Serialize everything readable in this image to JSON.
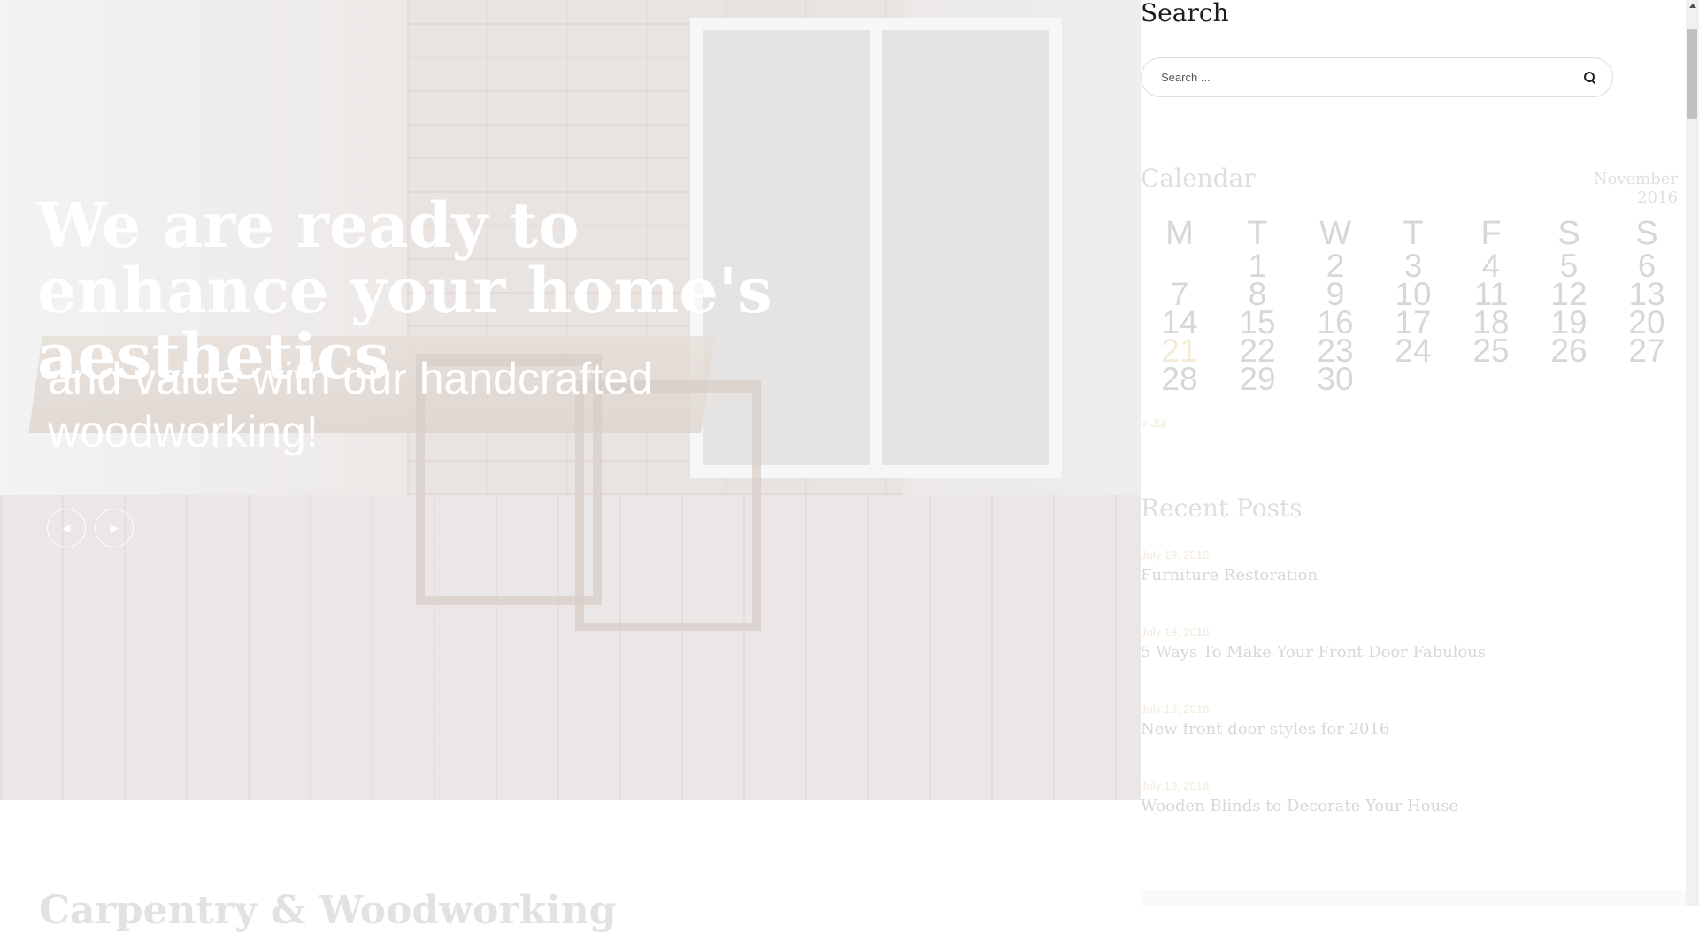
{
  "hero": {
    "title": "We are ready to enhance your home's aesthetics",
    "subtitle": "and value with our handcrafted woodworking!",
    "prev_icon": "prev-arrow-icon",
    "next_icon": "next-arrow-icon",
    "prev_glyph": "◀",
    "next_glyph": "▶"
  },
  "section_peek": "Carpentry & Woodworking",
  "sidebar": {
    "search": {
      "title": "Search",
      "placeholder": "Search ...",
      "icon": "search-icon"
    },
    "calendar": {
      "title": "Calendar",
      "month": "November 2016",
      "headers": [
        "M",
        "T",
        "W",
        "T",
        "F",
        "S",
        "S"
      ],
      "weeks": [
        [
          "",
          "1",
          "2",
          "3",
          "4",
          "5",
          "6"
        ],
        [
          "7",
          "8",
          "9",
          "10",
          "11",
          "12",
          "13"
        ],
        [
          "14",
          "15",
          "16",
          "17",
          "18",
          "19",
          "20"
        ],
        [
          "21",
          "22",
          "23",
          "24",
          "25",
          "26",
          "27"
        ],
        [
          "28",
          "29",
          "30",
          "",
          "",
          "",
          ""
        ]
      ],
      "highlight_day": "21",
      "prev_link": "« Jul"
    },
    "recent_posts": {
      "title": "Recent Posts",
      "items": [
        {
          "date": "July 19, 2016",
          "title": "Furniture Restoration"
        },
        {
          "date": "July 19, 2016",
          "title": "5 Ways To Make Your Front Door Fabulous"
        },
        {
          "date": "July 19, 2016",
          "title": "New front door styles for 2016"
        },
        {
          "date": "July 19, 2016",
          "title": "Wooden Blinds to Decorate Your House"
        }
      ]
    }
  },
  "colors": {
    "accent": "#c9a14b",
    "hero_text": "#ffffff",
    "widget_title": "#1e1e1e"
  }
}
